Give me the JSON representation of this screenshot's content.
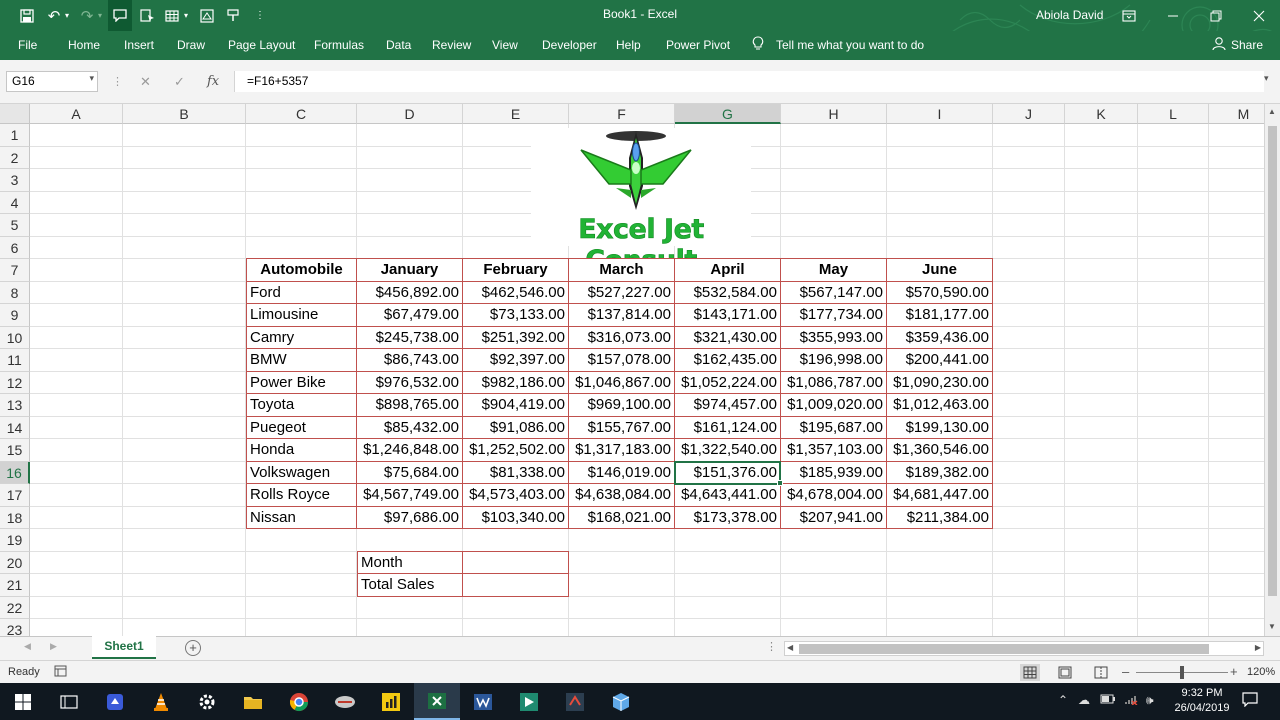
{
  "window": {
    "title": "Book1  -  Excel",
    "user": "Abiola David"
  },
  "ribbon_tabs": [
    "File",
    "Home",
    "Insert",
    "Draw",
    "Page Layout",
    "Formulas",
    "Data",
    "Review",
    "View",
    "Developer",
    "Help",
    "Power Pivot"
  ],
  "tell_me": "Tell me what you want to do",
  "share": "Share",
  "formula_bar": {
    "name_box": "G16",
    "formula": "=F16+5357"
  },
  "columns": [
    "A",
    "B",
    "C",
    "D",
    "E",
    "F",
    "G",
    "H",
    "I",
    "J",
    "K",
    "L",
    "M"
  ],
  "rows": [
    "1",
    "2",
    "3",
    "4",
    "5",
    "6",
    "7",
    "8",
    "9",
    "10",
    "11",
    "12",
    "13",
    "14",
    "15",
    "16",
    "17",
    "18",
    "19",
    "20",
    "21",
    "22",
    "23"
  ],
  "logo": {
    "text": "Excel Jet Consult"
  },
  "table": {
    "headers": [
      "Automobile",
      "January",
      "February",
      "March",
      "April",
      "May",
      "June"
    ],
    "rows": [
      [
        "Ford",
        "$456,892.00",
        "$462,546.00",
        "$527,227.00",
        "$532,584.00",
        "$567,147.00",
        "$570,590.00"
      ],
      [
        "Limousine",
        "$67,479.00",
        "$73,133.00",
        "$137,814.00",
        "$143,171.00",
        "$177,734.00",
        "$181,177.00"
      ],
      [
        "Camry",
        "$245,738.00",
        "$251,392.00",
        "$316,073.00",
        "$321,430.00",
        "$355,993.00",
        "$359,436.00"
      ],
      [
        "BMW",
        "$86,743.00",
        "$92,397.00",
        "$157,078.00",
        "$162,435.00",
        "$196,998.00",
        "$200,441.00"
      ],
      [
        "Power Bike",
        "$976,532.00",
        "$982,186.00",
        "$1,046,867.00",
        "$1,052,224.00",
        "$1,086,787.00",
        "$1,090,230.00"
      ],
      [
        "Toyota",
        "$898,765.00",
        "$904,419.00",
        "$969,100.00",
        "$974,457.00",
        "$1,009,020.00",
        "$1,012,463.00"
      ],
      [
        "Puegeot",
        "$85,432.00",
        "$91,086.00",
        "$155,767.00",
        "$161,124.00",
        "$195,687.00",
        "$199,130.00"
      ],
      [
        "Honda",
        "$1,246,848.00",
        "$1,252,502.00",
        "$1,317,183.00",
        "$1,322,540.00",
        "$1,357,103.00",
        "$1,360,546.00"
      ],
      [
        "Volkswagen",
        "$75,684.00",
        "$81,338.00",
        "$146,019.00",
        "$151,376.00",
        "$185,939.00",
        "$189,382.00"
      ],
      [
        "Rolls Royce",
        "$4,567,749.00",
        "$4,573,403.00",
        "$4,638,084.00",
        "$4,643,441.00",
        "$4,678,004.00",
        "$4,681,447.00"
      ],
      [
        "Nissan",
        "$97,686.00",
        "$103,340.00",
        "$168,021.00",
        "$173,378.00",
        "$207,941.00",
        "$211,384.00"
      ]
    ]
  },
  "lookup": {
    "month_label": "Month",
    "total_label": "Total Sales",
    "month_value": "",
    "total_value": ""
  },
  "sheet_tab": "Sheet1",
  "status": {
    "mode": "Ready",
    "zoom": "120%"
  },
  "taskbar": {
    "time": "9:32 PM",
    "date": "26/04/2019"
  },
  "colors": {
    "excel_green": "#217346",
    "table_border": "#c0504d",
    "logo_green": "#21b335"
  },
  "selected_cell": {
    "column": "G",
    "row": "16"
  }
}
